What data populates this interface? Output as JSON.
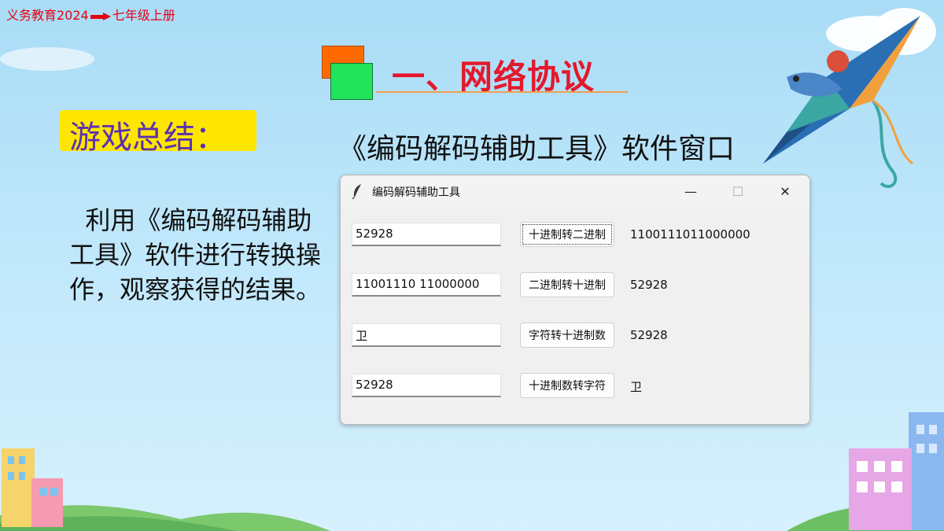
{
  "header": {
    "breadcrumb_left": "义务教育2024",
    "breadcrumb_right": "七年级上册",
    "title": "一、网络协议"
  },
  "summary_badge": "游戏总结：",
  "subtitle": "《编码解码辅助工具》软件窗口",
  "body_text": "  利用《编码解码辅助工具》软件进行转换操作，观察获得的结果。",
  "app_window": {
    "title": "编码解码辅助工具",
    "controls": {
      "minimize": "—",
      "maximize": "☐",
      "close": "✕"
    },
    "rows": [
      {
        "input": "52928",
        "button": "十进制转二进制",
        "output": "1100111011000000"
      },
      {
        "input": "11001110 11000000",
        "button": "二进制转十进制",
        "output": "52928"
      },
      {
        "input": "卫",
        "button": "字符转十进制数",
        "output": "52928"
      },
      {
        "input": "52928",
        "button": "十进制数转字符",
        "output": "卫"
      }
    ]
  },
  "colors": {
    "title_red": "#e4182b",
    "breadcrumb_red": "#e60012",
    "badge_yellow": "#ffe600",
    "badge_text": "#5b2fb5"
  }
}
